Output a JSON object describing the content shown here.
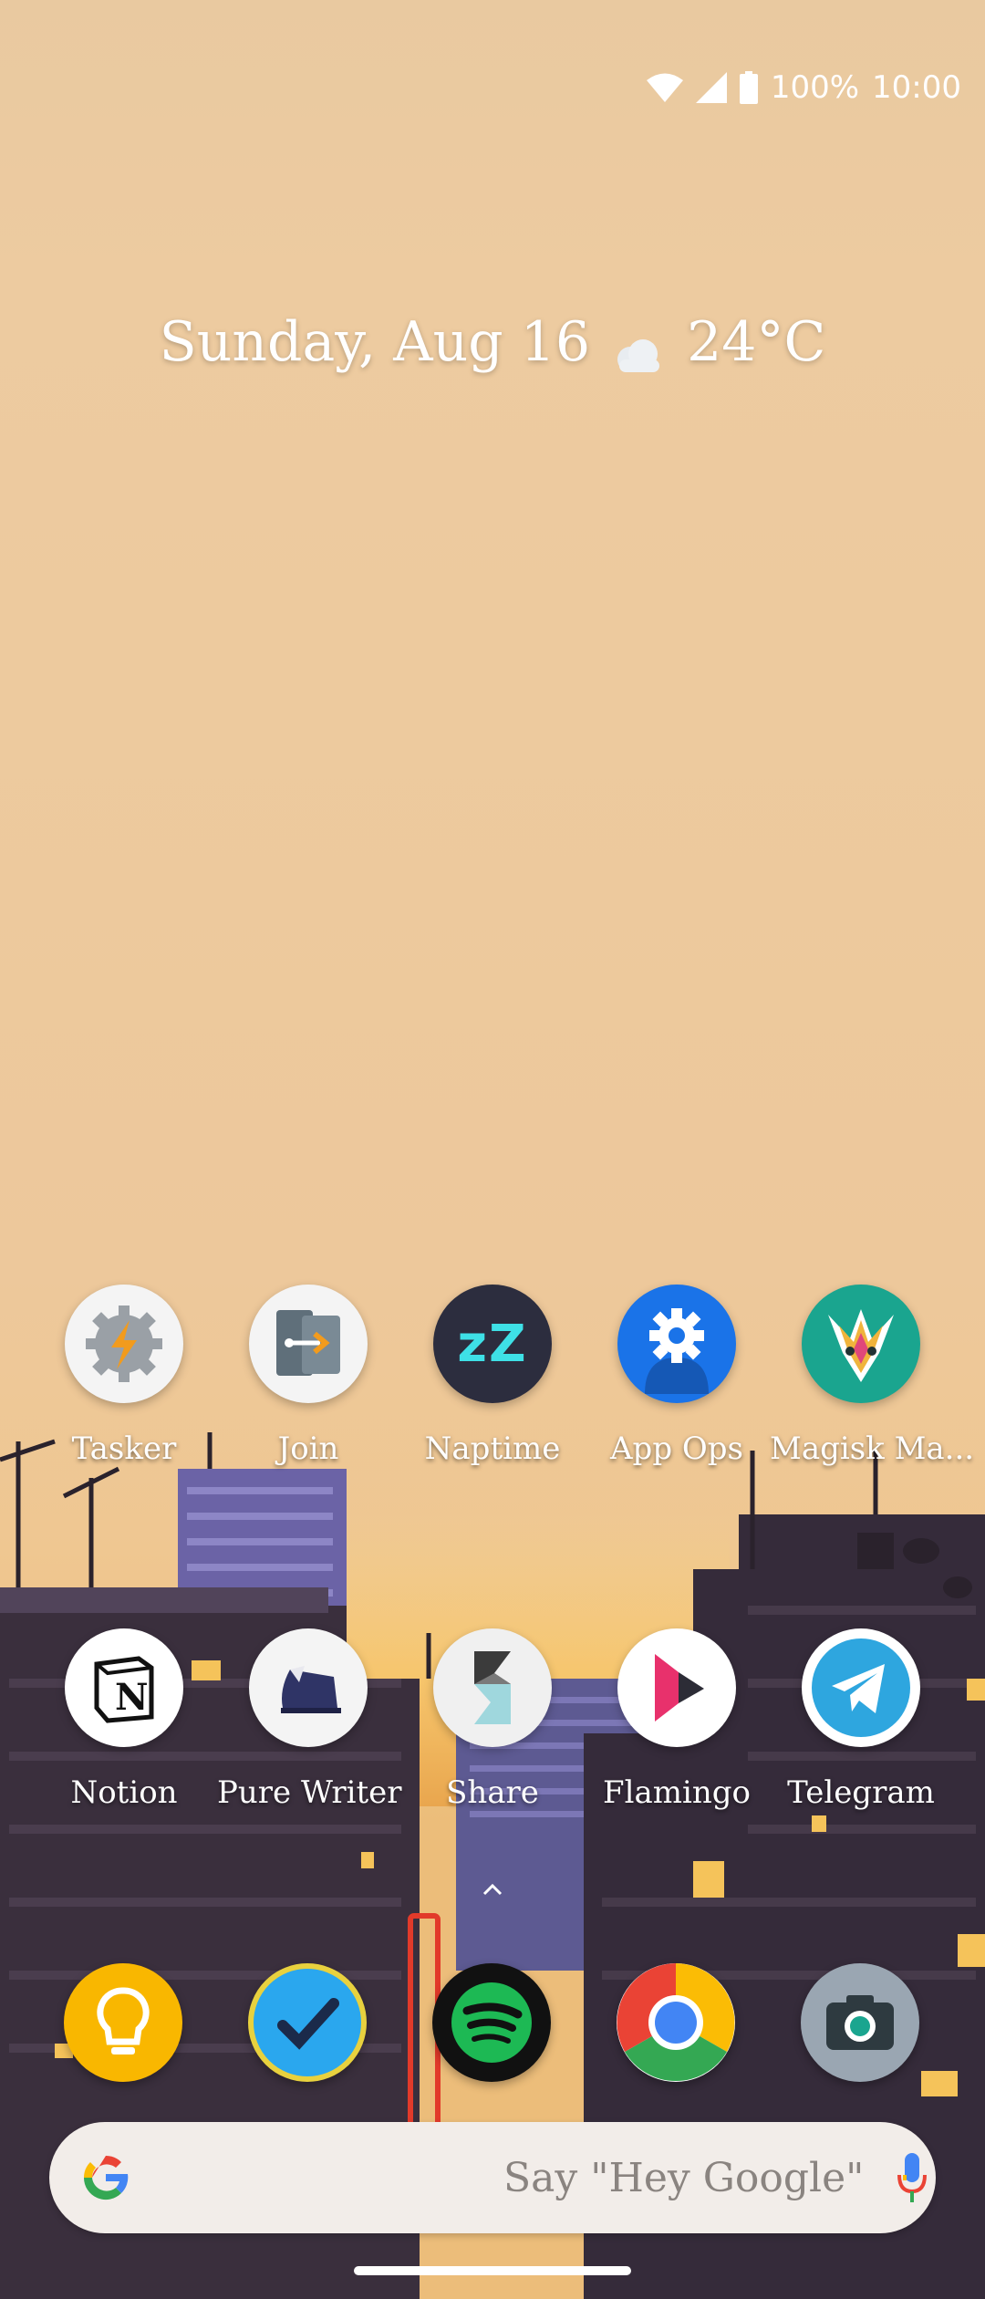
{
  "status_bar": {
    "battery": "100%",
    "time": "10:00",
    "icons": [
      "wifi-icon",
      "cellular-signal-icon",
      "battery-icon"
    ]
  },
  "at_a_glance": {
    "date": "Sunday, Aug 16",
    "weather_icon": "cloud-icon",
    "temperature": "24°C"
  },
  "home_grid": {
    "row1": [
      {
        "label": "Tasker",
        "icon": "tasker-icon"
      },
      {
        "label": "Join",
        "icon": "join-icon"
      },
      {
        "label": "Naptime",
        "icon": "naptime-icon"
      },
      {
        "label": "App Ops",
        "icon": "app-ops-icon"
      },
      {
        "label": "Magisk Ma...",
        "icon": "magisk-icon"
      }
    ],
    "row2": [
      {
        "label": "Notion",
        "icon": "notion-icon"
      },
      {
        "label": "Pure Writer",
        "icon": "pure-writer-icon"
      },
      {
        "label": "Share",
        "icon": "share-icon"
      },
      {
        "label": "Flamingo",
        "icon": "flamingo-icon"
      },
      {
        "label": "Telegram",
        "icon": "telegram-icon"
      }
    ]
  },
  "dock": [
    "keep-notes-icon",
    "tasks-check-icon",
    "spotify-icon",
    "chrome-icon",
    "camera-icon"
  ],
  "search_bar": {
    "hint": "Say \"Hey Google\"",
    "icons": [
      "google-g-icon",
      "mic-icon"
    ]
  },
  "colors": {
    "sky": "#edc89b",
    "app_ops_blue": "#1a73e8",
    "telegram_blue": "#2ea6df",
    "spotify_green": "#1db954",
    "keep_yellow": "#f9b700"
  }
}
